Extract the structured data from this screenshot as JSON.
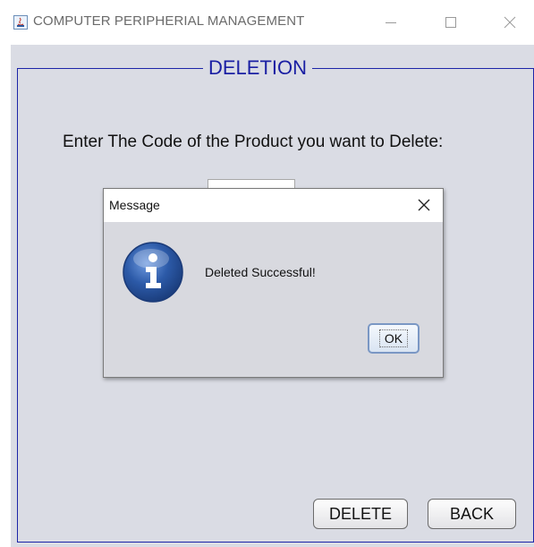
{
  "window": {
    "title": "COMPUTER PERIPHERIAL MANAGEMENT",
    "icon": "java-app-icon",
    "controls": [
      "minimize-icon",
      "maximize-icon",
      "close-icon"
    ]
  },
  "panel": {
    "group_title": "DELETION",
    "prompt": "Enter The Code of the Product you want to Delete:",
    "code_input": {
      "value": "",
      "placeholder": ""
    },
    "delete_label": "DELETE",
    "back_label": "BACK"
  },
  "dialog": {
    "title": "Message",
    "icon": "info-icon",
    "message": "Deleted Successful!",
    "ok_label": "OK"
  },
  "colors": {
    "accent": "#1a1fa3",
    "panel_bg": "#dadce4",
    "info_blue": "#2c5aa8"
  }
}
